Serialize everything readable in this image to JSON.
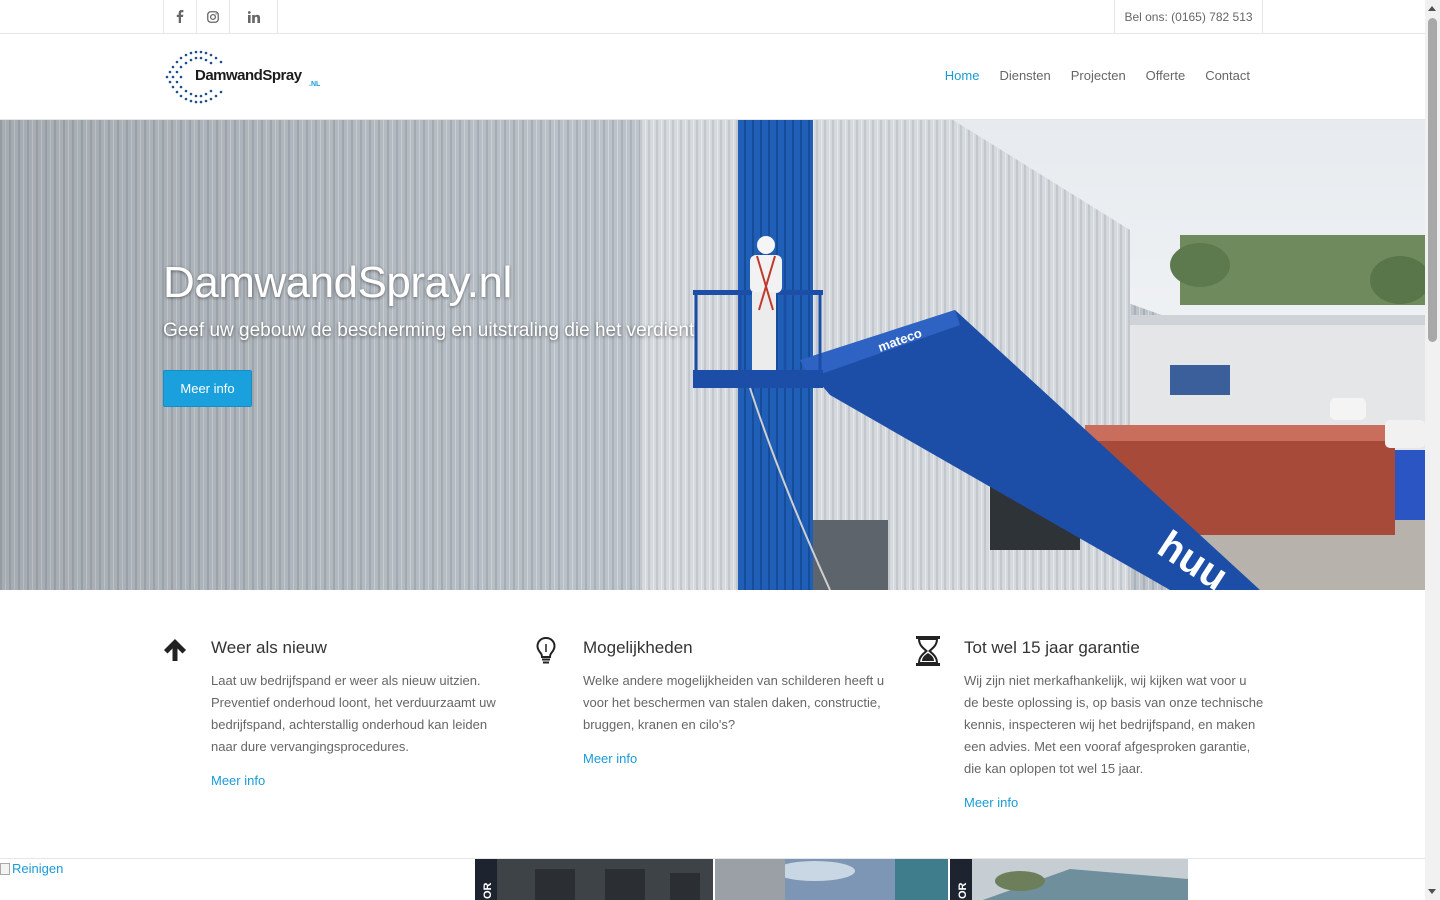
{
  "topbar": {
    "socials": [
      {
        "name": "facebook-icon",
        "glyph": "f"
      },
      {
        "name": "instagram-icon",
        "glyph": "◎"
      },
      {
        "name": "linkedin-icon",
        "glyph": "in"
      }
    ],
    "phone": "Bel ons: (0165) 782 513"
  },
  "header": {
    "logo_text": "DamwandSpray",
    "logo_suffix": ".NL",
    "nav": [
      {
        "label": "Home",
        "active": true
      },
      {
        "label": "Diensten",
        "active": false
      },
      {
        "label": "Projecten",
        "active": false
      },
      {
        "label": "Offerte",
        "active": false
      },
      {
        "label": "Contact",
        "active": false
      }
    ]
  },
  "hero": {
    "title": "DamwandSpray.nl",
    "subtitle": "Geef uw gebouw de bescherming en uitstraling die het verdient",
    "button": "Meer info",
    "lift_brand": "mateco",
    "lift_text": "huu"
  },
  "features": [
    {
      "icon": "arrow-up-icon",
      "title": "Weer als nieuw",
      "text": "Laat uw bedrijfspand er weer als nieuw uitzien. Preventief onderhoud loont, het verduurzaamt uw bedrijfspand, achterstallig onderhoud kan leiden naar dure vervangingsprocedures.",
      "link": "Meer info"
    },
    {
      "icon": "lightbulb-icon",
      "title": "Mogelijkheden",
      "text": "Welke andere mogelijkheiden van schilderen heeft u voor het beschermen van stalen daken, constructie, bruggen, kranen en cilo's?",
      "link": "Meer info"
    },
    {
      "icon": "hourglass-icon",
      "title": "Tot wel 15 jaar garantie",
      "text": "Wij zijn niet merkafhankelijk, wij kijken wat voor u de beste oplossing is, op basis van onze technische kennis, inspecteren wij het bedrijfspand, en maken een advies. Met een vooraf afgesproken garantie, die kan oplopen tot wel 15 jaar.",
      "link": "Meer info"
    }
  ],
  "strip": {
    "broken_image_alt": "Reinigen",
    "thumb_letters": "OR"
  },
  "colors": {
    "accent": "#1a9bd7",
    "button": "#1aa0dc"
  }
}
